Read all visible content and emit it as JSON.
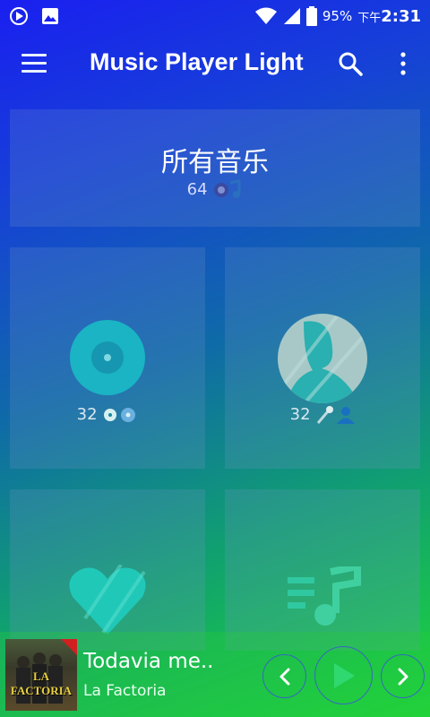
{
  "status_bar": {
    "battery_percent": "95%",
    "time_prefix": "下午",
    "time": "2:31",
    "icons": [
      "play-notification-icon",
      "image-notification-icon",
      "wifi-icon",
      "signal-icon",
      "battery-icon"
    ]
  },
  "app_bar": {
    "title": "Music Player Light",
    "icons": [
      "menu-icon",
      "search-icon",
      "more-vert-icon"
    ]
  },
  "tiles": {
    "all_music": {
      "label": "所有音乐",
      "count": "64",
      "icon": "songs-icon"
    },
    "albums": {
      "count": "32",
      "icon": "album-disc-icon"
    },
    "artists": {
      "count": "32",
      "icon": "artist-icon"
    },
    "favorites": {
      "icon": "heart-icon"
    },
    "playlists": {
      "icon": "playlist-icon"
    }
  },
  "now_playing": {
    "title": "Todavia me..",
    "artist": "La Factoria",
    "album_art_text": "LA FACTORIA",
    "controls": [
      "previous-icon",
      "play-icon",
      "next-icon"
    ]
  },
  "colors": {
    "gradient_top": "#1a1ff0",
    "gradient_bottom": "#1fd838",
    "accent_teal": "#1ec8c8",
    "control_ring": "#3c50dc"
  }
}
